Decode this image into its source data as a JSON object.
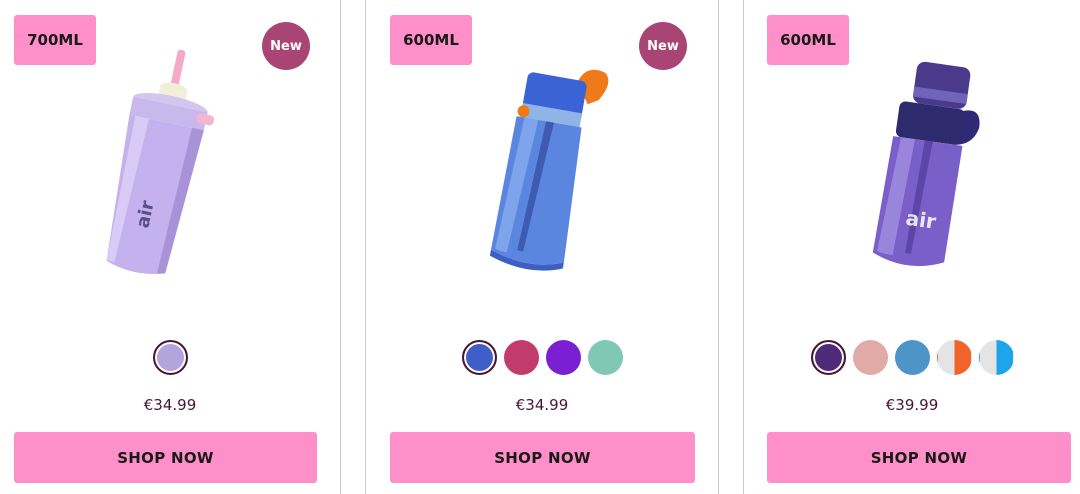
{
  "products": [
    {
      "size": "700ML",
      "badge": "New",
      "swatches": [
        "#b2a5de"
      ],
      "price": "€34.99",
      "cta": "SHOP NOW"
    },
    {
      "size": "600ML",
      "badge": "New",
      "swatches": [
        "#3f5ec8",
        "#c33b6b",
        "#7a1fd1",
        "#7fc8b3"
      ],
      "price": "€34.99",
      "cta": "SHOP NOW"
    },
    {
      "size": "600ML",
      "swatches": [
        "#4e2a78",
        "#e0aaa6",
        "#4d94c7",
        "orange-half",
        "blue-half"
      ],
      "price": "€39.99",
      "cta": "SHOP NOW"
    }
  ],
  "colors": {
    "badge_pink": "#ff8fc9",
    "new_badge": "#a84575",
    "price_text": "#4a1530"
  }
}
